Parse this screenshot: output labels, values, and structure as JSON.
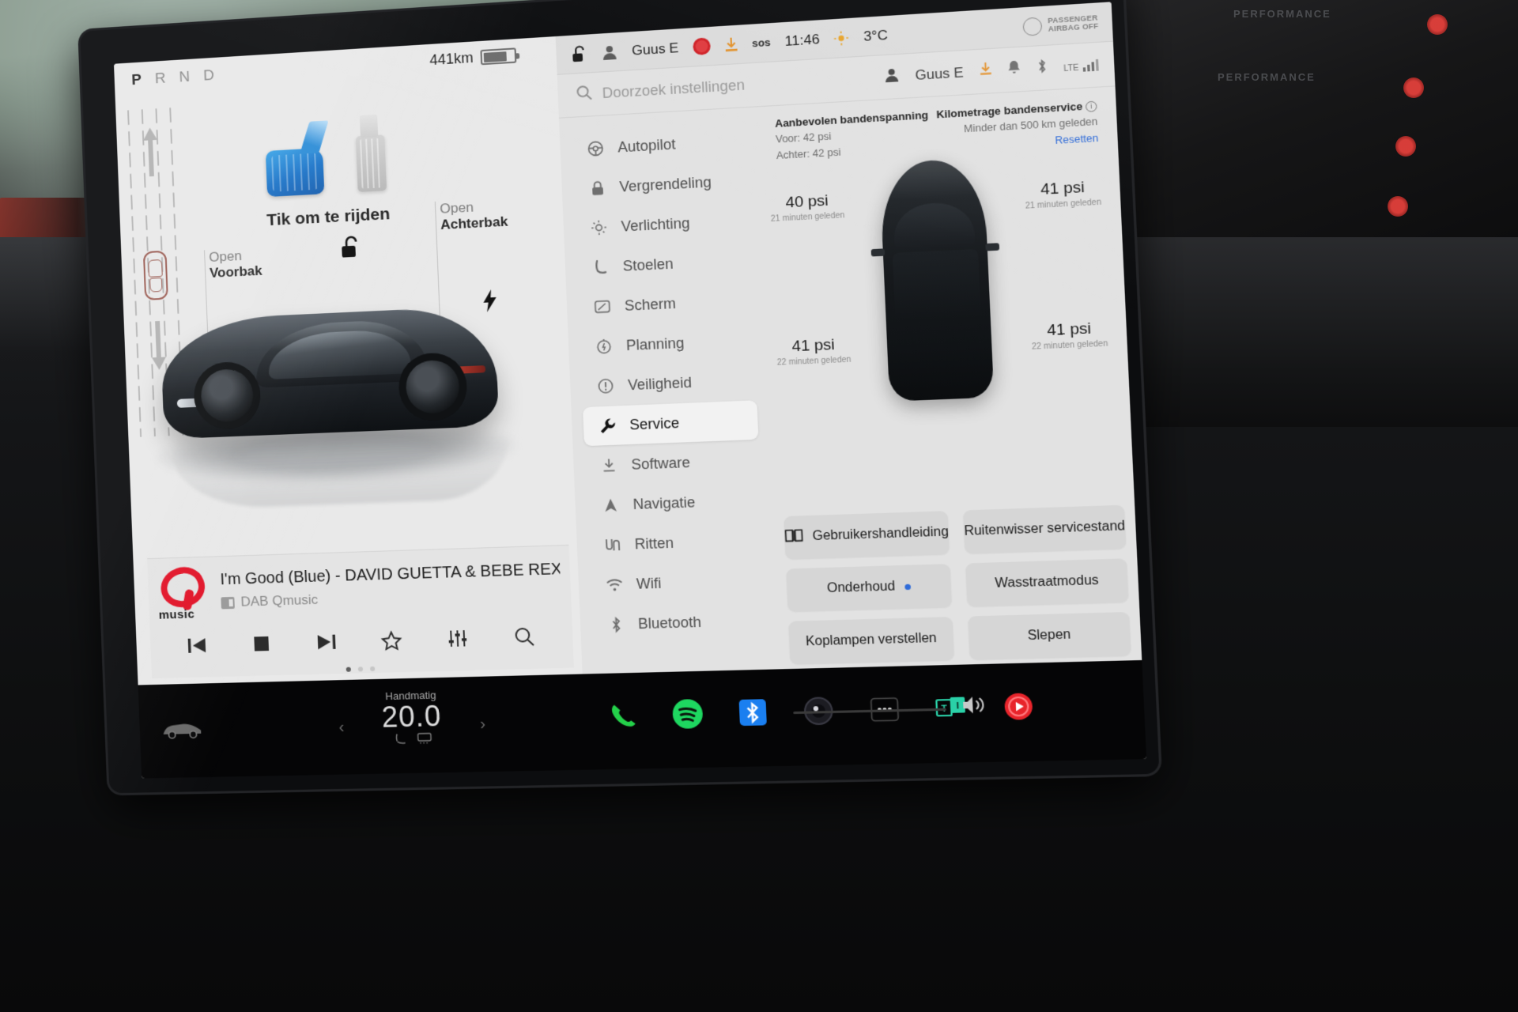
{
  "left_panel": {
    "gear_indicator": {
      "full": "PRND",
      "active": "P"
    },
    "drive_prompt": "Tik om te rijden",
    "frunk": {
      "line1": "Open",
      "line2": "Voorbak"
    },
    "trunk": {
      "line1": "Open",
      "line2": "Achterbak"
    },
    "icons": {
      "accel_pedal": "accelerator-pedal-icon",
      "brake_pedal": "brake-pedal-icon",
      "unlock": "unlock-icon",
      "charge_port": "charge-bolt-icon",
      "car_side": "car-side-icon"
    }
  },
  "media": {
    "logo_word": "music",
    "track": "I'm Good (Blue) - DAVID GUETTA & BEBE REXHA",
    "source_label": "DAB Qmusic",
    "controls": [
      "previous-track-button",
      "stop-button",
      "next-track-button",
      "favorite-star-button",
      "equalizer-button",
      "search-button"
    ],
    "page_dots": 3,
    "active_dot": 0
  },
  "status_bar": {
    "range": "441km",
    "battery_level_pct": 70,
    "lock_state": "unlocked",
    "driver_profile": "Guus E",
    "recording": "dashcam-recording-icon",
    "download": "software-download-icon",
    "sos": "sos",
    "time": "11:46",
    "weather_icon": "sun-icon",
    "outside_temp": "3°C",
    "airbag_line1": "PASSENGER",
    "airbag_line2": "AIRBAG OFF"
  },
  "search": {
    "placeholder": "Doorzoek instellingen",
    "profile_name": "Guus E",
    "tray_icons": [
      "software-download-icon",
      "bell-icon",
      "bluetooth-icon"
    ],
    "signal_label": "LTE"
  },
  "menu": {
    "items": [
      {
        "label": "Autopilot",
        "icon": "steering-wheel-icon",
        "active": false
      },
      {
        "label": "Vergrendeling",
        "icon": "lock-icon",
        "active": false
      },
      {
        "label": "Verlichting",
        "icon": "light-bulb-icon",
        "active": false
      },
      {
        "label": "Stoelen",
        "icon": "seat-icon",
        "active": false
      },
      {
        "label": "Scherm",
        "icon": "display-icon",
        "active": false
      },
      {
        "label": "Planning",
        "icon": "schedule-clock-icon",
        "active": false
      },
      {
        "label": "Veiligheid",
        "icon": "warning-circle-icon",
        "active": false
      },
      {
        "label": "Service",
        "icon": "wrench-icon",
        "active": true
      },
      {
        "label": "Software",
        "icon": "download-icon",
        "active": false
      },
      {
        "label": "Navigatie",
        "icon": "navigation-arrow-icon",
        "active": false
      },
      {
        "label": "Ritten",
        "icon": "trips-icon",
        "active": false
      },
      {
        "label": "Wifi",
        "icon": "wifi-icon",
        "active": false
      },
      {
        "label": "Bluetooth",
        "icon": "bluetooth-icon",
        "active": false
      }
    ]
  },
  "service": {
    "recommended_title": "Aanbevolen bandenspanning",
    "recommended_front": "Voor: 42 psi",
    "recommended_rear": "Achter: 42 psi",
    "mileage_title": "Kilometrage bandenservice",
    "mileage_value": "Minder dan 500 km geleden",
    "reset_link": "Resetten",
    "tires": [
      {
        "position": "front-left",
        "value": "40 psi",
        "time": "21 minuten geleden"
      },
      {
        "position": "front-right",
        "value": "41 psi",
        "time": "21 minuten geleden"
      },
      {
        "position": "rear-left",
        "value": "41 psi",
        "time": "22 minuten geleden"
      },
      {
        "position": "rear-right",
        "value": "41 psi",
        "time": "22 minuten geleden"
      }
    ],
    "buttons": [
      {
        "label": "Gebruikershandleiding",
        "icon": "book-icon",
        "badge": false
      },
      {
        "label": "Ruitenwisser servicestand",
        "icon": null,
        "badge": false
      },
      {
        "label": "Onderhoud",
        "icon": null,
        "badge": true
      },
      {
        "label": "Wasstraatmodus",
        "icon": null,
        "badge": false
      },
      {
        "label": "Koplampen verstellen",
        "icon": null,
        "badge": false
      },
      {
        "label": "Slepen",
        "icon": null,
        "badge": false
      }
    ]
  },
  "taskbar": {
    "car_icon": "car-controls-icon",
    "climate_mode": "Handmatig",
    "climate_temp": "20.0",
    "apps": [
      {
        "name": "phone-app-icon",
        "color": "#24d14a"
      },
      {
        "name": "spotify-app-icon",
        "color": "#1ed760"
      },
      {
        "name": "bluetooth-app-icon",
        "color": "#1a7ff0"
      },
      {
        "name": "camera-app-icon",
        "color": "#3a3a44"
      },
      {
        "name": "more-apps-icon",
        "color": "#cfcfcf"
      },
      {
        "name": "tunein-app-icon",
        "color": "#2ad1a8"
      },
      {
        "name": "youtube-app-icon",
        "color": "#e8242b"
      }
    ],
    "volume_icon": "volume-icon"
  },
  "colors": {
    "screen_bg": "#e9e9e9",
    "panel_bg": "#e2e2e2",
    "accent_blue": "#2f6bd8",
    "record_red": "#e03b3f",
    "pedal_blue": "#1e74c8"
  }
}
